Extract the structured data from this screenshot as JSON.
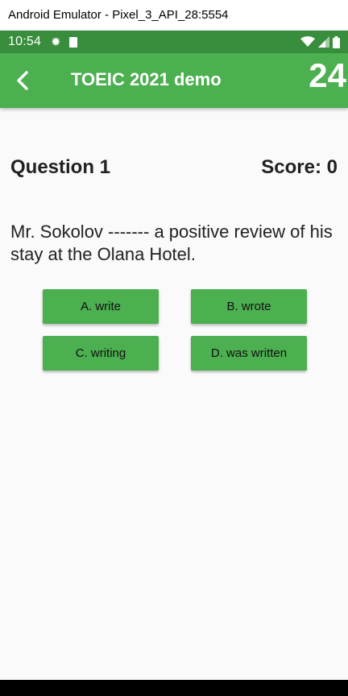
{
  "window": {
    "title": "Android Emulator - Pixel_3_API_28:5554"
  },
  "status_bar": {
    "time": "10:54",
    "icons": [
      "settings-icon",
      "sd-card-icon",
      "wifi-icon",
      "signal-icon",
      "battery-icon"
    ]
  },
  "app_bar": {
    "title": "TOEIC 2021 demo",
    "timer": "24",
    "back_icon": "back-arrow-icon"
  },
  "quiz": {
    "question_label": "Question 1",
    "score_label": "Score: 0",
    "question_text": "Mr. Sokolov ------- a positive review of his stay at the Olana Hotel.",
    "answers": [
      "A. write",
      "B. wrote",
      "C. writing",
      "D. was written"
    ]
  },
  "colors": {
    "app_bar": "#4caf50",
    "status_bar": "#388e3c",
    "button": "#4caf50",
    "background": "#fafafa"
  }
}
